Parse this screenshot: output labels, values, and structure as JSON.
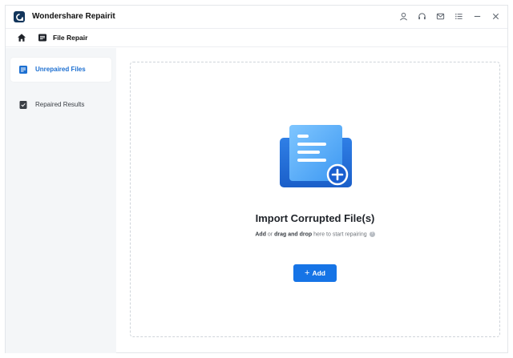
{
  "app": {
    "title": "Wondershare Repairit",
    "window_icons": [
      "user-icon",
      "headset-icon",
      "mail-icon",
      "list-menu-icon",
      "minimize-icon",
      "close-icon"
    ]
  },
  "breadcrumb": {
    "current": "File Repair"
  },
  "sidebar": {
    "items": [
      {
        "label": "Unrepaired Files",
        "active": true
      },
      {
        "label": "Repaired Results",
        "active": false
      }
    ]
  },
  "dropzone": {
    "title": "Import Corrupted File(s)",
    "subtitle_parts": [
      "Add",
      " or ",
      "drag and drop",
      " here to start repairing"
    ],
    "add_button": {
      "icon": "+",
      "label": "Add"
    }
  },
  "colors": {
    "accent": "#1674e6",
    "sidebar_bg": "#f4f6f8",
    "active_label": "#1c6fd1"
  }
}
